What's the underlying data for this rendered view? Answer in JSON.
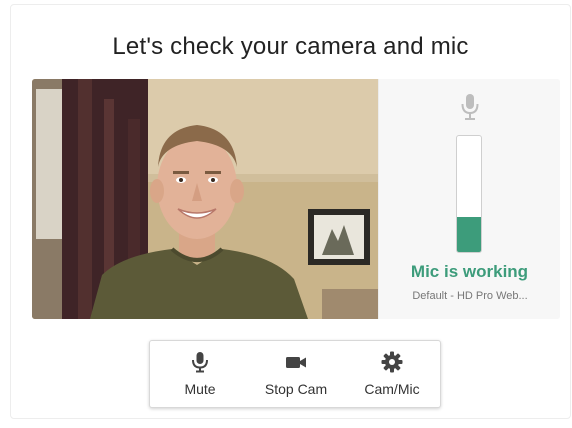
{
  "title": "Let's check your camera and mic",
  "mic_panel": {
    "icon": "microphone-icon",
    "level": 0.3,
    "status": "Mic is working",
    "device": "Default - HD Pro Web..."
  },
  "toolbar": {
    "mute": {
      "label": "Mute",
      "icon": "microphone-icon"
    },
    "stop_cam": {
      "label": "Stop Cam",
      "icon": "video-camera-icon"
    },
    "cam_mic": {
      "label": "Cam/Mic",
      "icon": "gear-icon"
    }
  },
  "colors": {
    "accent": "#3d9c7b",
    "icon": "#444444",
    "mic_icon_muted": "#bdbdbd"
  }
}
